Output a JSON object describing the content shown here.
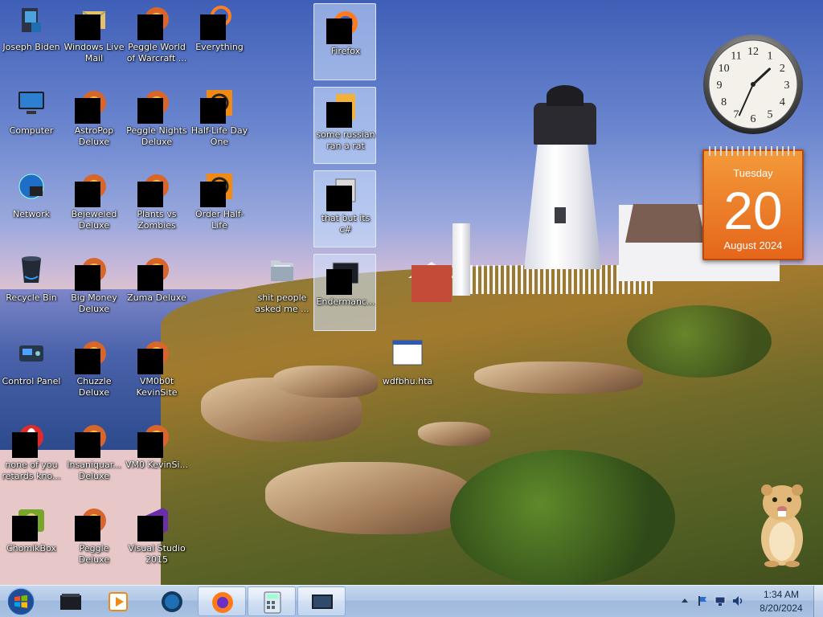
{
  "desktop": {
    "icons": [
      {
        "label": "Joseph Biden",
        "icon": "user-folder-icon"
      },
      {
        "label": "Windows Live Mail",
        "icon": "mail-icon"
      },
      {
        "label": "Peggle World of Warcraft ...",
        "icon": "game-icon"
      },
      {
        "label": "Everything",
        "icon": "search-icon"
      },
      {
        "label": "Firefox",
        "icon": "firefox-icon"
      },
      {
        "label": "Computer",
        "icon": "computer-icon"
      },
      {
        "label": "AstroPop Deluxe",
        "icon": "game-icon"
      },
      {
        "label": "Peggle Nights Deluxe",
        "icon": "game-icon"
      },
      {
        "label": "Half-Life Day One",
        "icon": "half-life-icon"
      },
      {
        "label": "some russian ran a rat",
        "icon": "file-icon"
      },
      {
        "label": "Network",
        "icon": "network-icon"
      },
      {
        "label": "Bejeweled Deluxe",
        "icon": "game-icon"
      },
      {
        "label": "Plants vs Zombies",
        "icon": "game-icon"
      },
      {
        "label": "Order Half-Life",
        "icon": "half-life-icon"
      },
      {
        "label": "that but its c#",
        "icon": "shortcut-icon"
      },
      {
        "label": "Recycle Bin",
        "icon": "recycle-bin-icon"
      },
      {
        "label": "Big Money Deluxe",
        "icon": "game-icon"
      },
      {
        "label": "Zuma Deluxe",
        "icon": "game-icon"
      },
      {
        "label": "shit people asked me ...",
        "icon": "folder-icon"
      },
      {
        "label": "Endermanc...",
        "icon": "app-window-icon"
      },
      {
        "label": "Control Panel",
        "icon": "control-panel-icon"
      },
      {
        "label": "Chuzzle Deluxe",
        "icon": "game-icon"
      },
      {
        "label": "VM0b0t KevinSite",
        "icon": "app-icon"
      },
      {
        "label": "wdfbhu.hta",
        "icon": "hta-window-icon"
      },
      {
        "label": "none of you retards kno...",
        "icon": "opera-icon"
      },
      {
        "label": "Insaniquar... Deluxe",
        "icon": "game-icon"
      },
      {
        "label": "VM0 KevinSi...",
        "icon": "app-icon"
      },
      {
        "label": "ChomikBox",
        "icon": "chomikbox-icon"
      },
      {
        "label": "Peggle Deluxe",
        "icon": "game-icon"
      },
      {
        "label": "Visual Studio 2015",
        "icon": "visual-studio-icon"
      }
    ]
  },
  "gadgets": {
    "clock": {
      "hour": 1,
      "minute": 34,
      "numerals": [
        "12",
        "1",
        "2",
        "3",
        "4",
        "5",
        "6",
        "7",
        "8",
        "9",
        "10",
        "11"
      ]
    },
    "calendar": {
      "weekday": "Tuesday",
      "day": "20",
      "month_year": "August 2024"
    }
  },
  "taskbar": {
    "pinned": [
      "folder-icon",
      "media-player-icon",
      "globe-icon",
      "firefox-icon",
      "calculator-icon",
      "monitor-icon"
    ],
    "tray": {
      "time": "1:34 AM",
      "date": "8/20/2024"
    }
  },
  "colors": {
    "calendar_orange": "#e9711f",
    "taskbar": "#b1c8e6"
  }
}
